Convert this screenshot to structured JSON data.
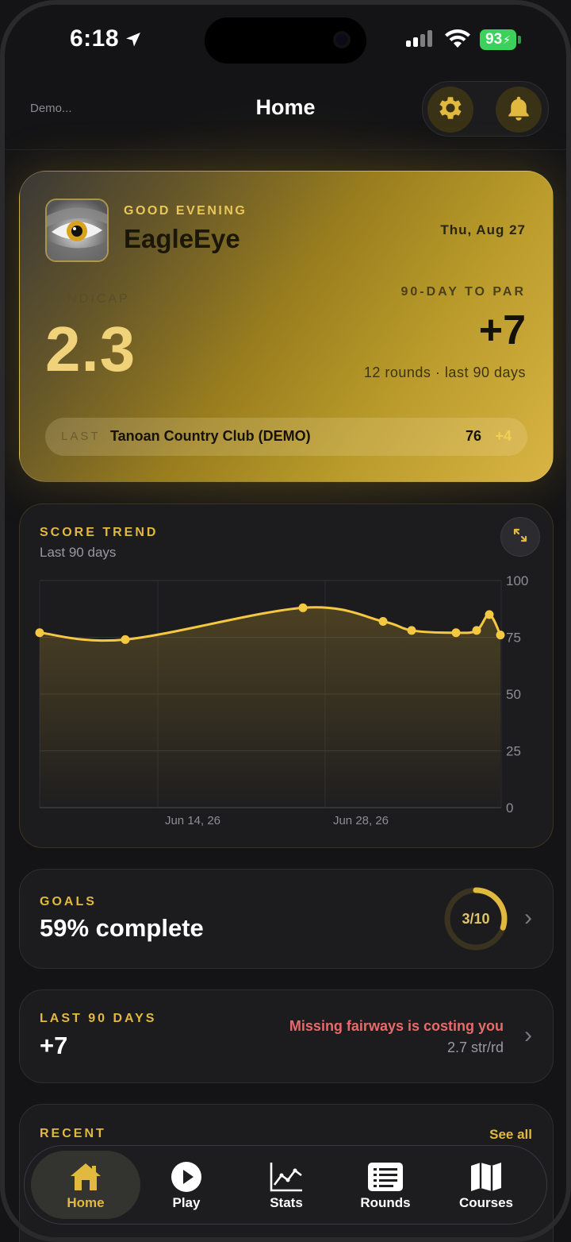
{
  "status_bar": {
    "time": "6:18",
    "battery": "93"
  },
  "header": {
    "demo_label": "Demo...",
    "title": "Home"
  },
  "hero": {
    "greeting": "GOOD EVENING",
    "username": "EagleEye",
    "date": "Thu, Aug 27",
    "handicap_label": "HANDICAP",
    "handicap_value": "2.3",
    "to_par_label": "90-DAY TO PAR",
    "to_par_value": "+7",
    "to_par_sub": "12 rounds · last 90 days",
    "last_label": "LAST",
    "last_course": "Tanoan Country Club (DEMO)",
    "last_score": "76",
    "last_to_par": "+4"
  },
  "score_trend": {
    "title": "SCORE TREND",
    "subtitle": "Last 90 days"
  },
  "chart_data": {
    "type": "line",
    "x_tick_labels": [
      "Jun 14, 26",
      "Jun 28, 26"
    ],
    "y_ticks": [
      0,
      25,
      50,
      75,
      100
    ],
    "ylim": [
      0,
      100
    ],
    "grid": true,
    "series": [
      {
        "values": [
          77,
          74,
          88,
          82,
          78,
          77,
          78,
          85,
          76
        ]
      }
    ]
  },
  "goals": {
    "label": "GOALS",
    "value": "59% complete",
    "progress_text": "3/10",
    "progress": 0.3
  },
  "last90": {
    "label": "LAST 90 DAYS",
    "value": "+7",
    "insight": "Missing fairways is costing you",
    "insight_sub": "2.7 str/rd"
  },
  "recent": {
    "label": "RECENT",
    "see_all": "See all"
  },
  "tabs": [
    {
      "label": "Home",
      "icon": "home-icon"
    },
    {
      "label": "Play",
      "icon": "play-icon"
    },
    {
      "label": "Stats",
      "icon": "stats-icon"
    },
    {
      "label": "Rounds",
      "icon": "rounds-icon"
    },
    {
      "label": "Courses",
      "icon": "courses-icon"
    }
  ],
  "colors": {
    "accent": "#E2B93F",
    "line": "#F5C842",
    "negative": "#E86A6A"
  }
}
